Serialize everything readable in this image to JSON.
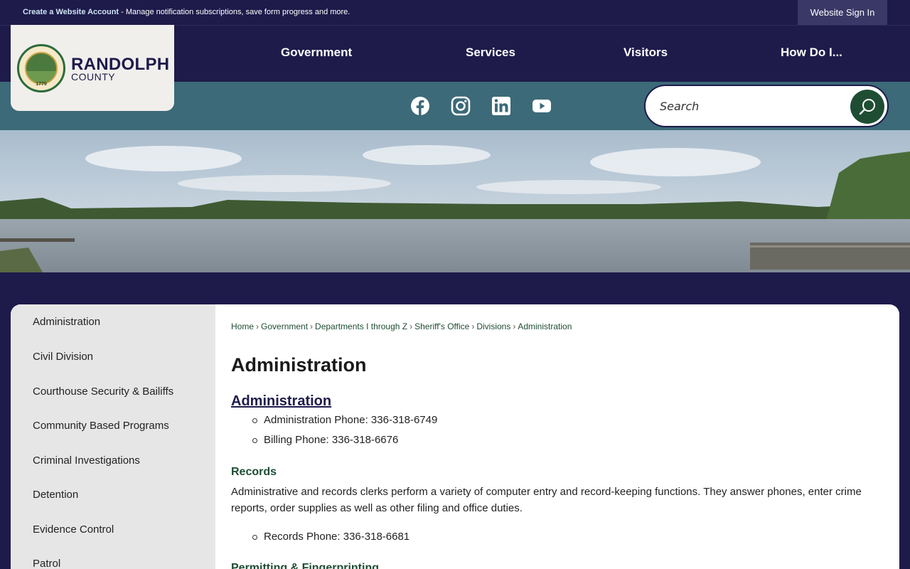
{
  "topbar": {
    "account_link": "Create a Website Account",
    "account_text": " - Manage notification subscriptions, save form progress and more.",
    "signin": "Website Sign In"
  },
  "logo": {
    "name": "RANDOLPH",
    "sub": "COUNTY",
    "seal_year": "1779"
  },
  "nav": {
    "items": [
      "Government",
      "Services",
      "Visitors",
      "How Do I..."
    ]
  },
  "social": {
    "icons": [
      "facebook-icon",
      "instagram-icon",
      "linkedin-icon",
      "youtube-icon"
    ]
  },
  "search": {
    "placeholder": "Search"
  },
  "sidenav": {
    "items": [
      "Administration",
      "Civil Division",
      "Courthouse Security & Bailiffs",
      "Community Based Programs",
      "Criminal Investigations",
      "Detention",
      "Evidence Control",
      "Patrol"
    ]
  },
  "breadcrumb": [
    "Home",
    "Government",
    "Departments I through Z",
    "Sheriff's Office",
    "Divisions",
    "Administration"
  ],
  "content": {
    "title": "Administration",
    "section_link": "Administration",
    "admin_bullets": [
      "Administration Phone: 336-318-6749",
      "Billing Phone: 336-318-6676"
    ],
    "records_heading": "Records",
    "records_text": "Administrative and records clerks perform a variety of computer entry and record-keeping functions. They answer phones, enter crime reports, order supplies as well as other filing and office duties.",
    "records_bullets": [
      "Records Phone: 336-318-6681"
    ],
    "permit_heading": "Permitting & Fingerprinting"
  },
  "colors": {
    "navy": "#1e1b4b",
    "teal": "#3c6a78",
    "green": "#1f4d33"
  }
}
